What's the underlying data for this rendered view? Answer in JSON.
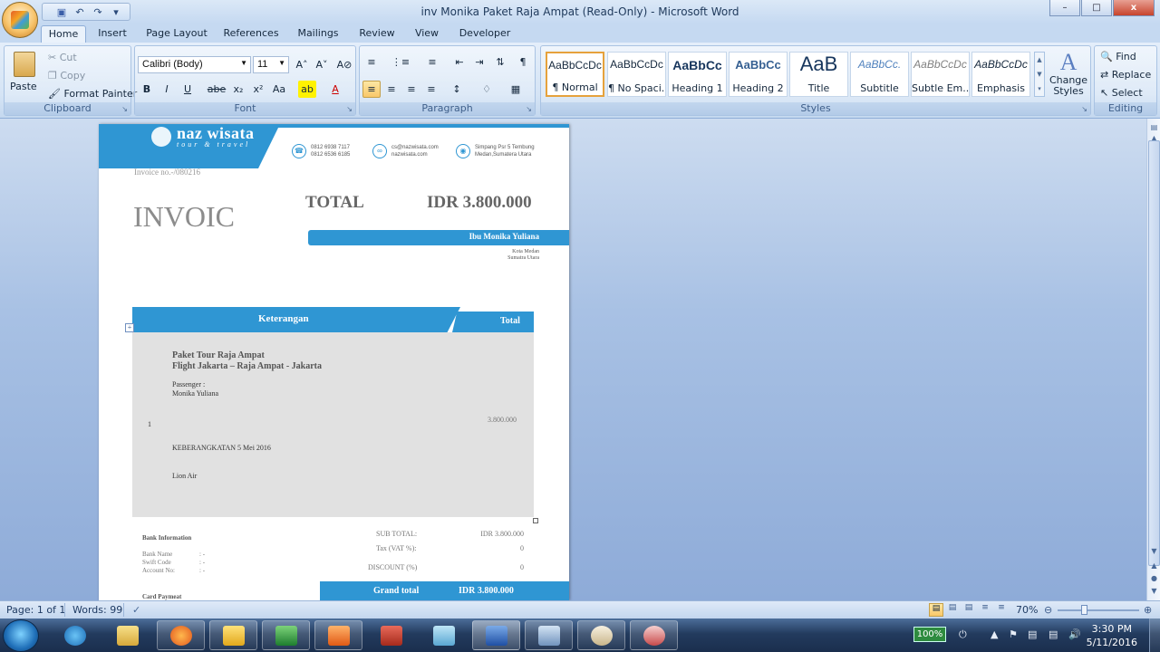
{
  "window": {
    "title": "inv Monika Paket Raja Ampat (Read-Only) - Microsoft Word",
    "minimize": "–",
    "maximize": "□",
    "close": "x"
  },
  "qat": {
    "save": "💾",
    "undo": "↶",
    "redo": "↷",
    "more": "▾"
  },
  "tabs": [
    "Home",
    "Insert",
    "Page Layout",
    "References",
    "Mailings",
    "Review",
    "View",
    "Developer"
  ],
  "ribbon": {
    "clipboard": {
      "label": "Clipboard",
      "paste": "Paste",
      "cut": "Cut",
      "copy": "Copy",
      "format_painter": "Format Painter"
    },
    "font": {
      "label": "Font",
      "family": "Calibri (Body)",
      "size": "11",
      "bold": "B",
      "italic": "I",
      "underline": "U",
      "strike": "abe",
      "sub": "x₂",
      "sup": "x²",
      "case": "Aa",
      "grow": "A˄",
      "shrink": "A˅",
      "clear": "A⊘",
      "highlight": "ab",
      "color": "A"
    },
    "paragraph": {
      "label": "Paragraph"
    },
    "styles": {
      "label": "Styles",
      "items": [
        {
          "sample": "AaBbCcDc",
          "name": "¶ Normal"
        },
        {
          "sample": "AaBbCcDc",
          "name": "¶ No Spaci..."
        },
        {
          "sample": "AaBbCc",
          "name": "Heading 1"
        },
        {
          "sample": "AaBbCc",
          "name": "Heading 2"
        },
        {
          "sample": "AaB",
          "name": "Title"
        },
        {
          "sample": "AaBbCc.",
          "name": "Subtitle"
        },
        {
          "sample": "AaBbCcDc",
          "name": "Subtle Em..."
        },
        {
          "sample": "AaBbCcDc",
          "name": "Emphasis"
        }
      ],
      "change_styles": "Change Styles"
    },
    "editing": {
      "label": "Editing",
      "find": "Find",
      "replace": "Replace",
      "select": "Select"
    }
  },
  "document": {
    "brand_name": "naz wisata",
    "brand_tag": "tour & travel",
    "phone1": "0812 6938 7117",
    "phone2": "0812 6536 6185",
    "email": "cs@nazwisata.com",
    "web": "nazwisata.com",
    "address1": "Simpang Psr 5 Tembung",
    "address2": "Medan,Sumatera Utara",
    "invoice_no": "Invoice no.-/080216",
    "total_label": "TOTAL",
    "total_value": "IDR  3.800.000",
    "heading": "INVOIC",
    "customer": "Ibu Monika Yuliana",
    "city": "Kota Medan",
    "province": "Sumatra  Utara",
    "col_desc": "Keterangan",
    "col_total": "Total",
    "item_title1": "Paket Tour Raja Ampat",
    "item_title2": "Flight Jakarta – Raja Ampat - Jakarta",
    "passenger_label": "Passenger :",
    "passenger_name": "Monika Yuliana",
    "qty": "1",
    "item_amount": "3.800.000",
    "departure": "KEBERANGKATAN 5 Mei 2016",
    "airline": "Lion Air",
    "bank_info": "Bank Information",
    "bank_name": "Bank Name",
    "swift": "Swift Code",
    "account": "Account No:",
    "colon_dash": ": -",
    "card_payment": "Card Paymeat",
    "subtotal_label": "SUB TOTAL:",
    "subtotal_value": "IDR 3.800.000",
    "tax_label": "Tax (VAT %):",
    "tax_value": "0",
    "discount_label": "DISCOUNT (%)",
    "discount_value": "0",
    "grand_label": "Grand total",
    "grand_value": "IDR  3.800.000"
  },
  "status": {
    "page": "Page: 1 of 1",
    "words": "Words: 99",
    "zoom": "70%"
  },
  "taskbar": {
    "battery": "100%",
    "time": "3:30 PM",
    "date": "5/11/2016"
  }
}
